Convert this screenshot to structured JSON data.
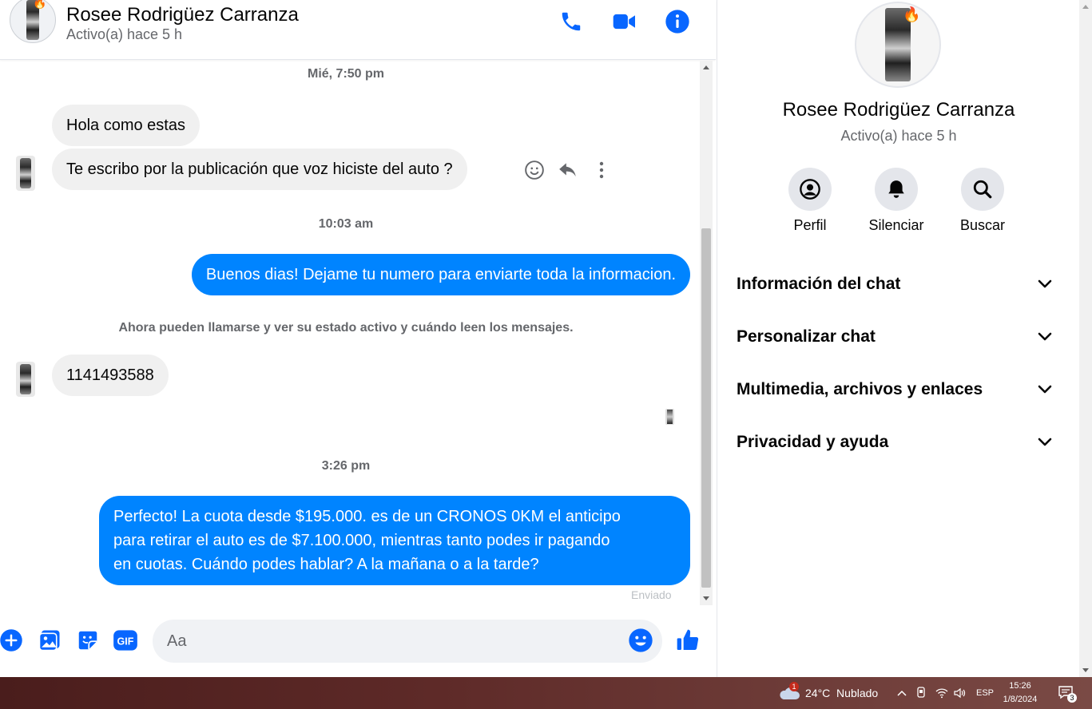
{
  "header": {
    "contact_name": "Rosee Rodrigüez Carranza",
    "status": "Activo(a) hace 5 h",
    "icons": [
      "phone-icon",
      "video-icon",
      "info-icon"
    ]
  },
  "messages": {
    "time_1": "Mié, 7:50 pm",
    "in_1": "Hola como estas",
    "in_2": "Te escribo por la publicación que voz hiciste del auto ?",
    "time_2": "10:03 am",
    "out_1": "Buenos dias! Dejame tu numero para enviarte toda la informacion.",
    "notice": "Ahora pueden llamarse y ver su estado activo y cuándo leen los mensajes.",
    "in_3": "1141493588",
    "time_3": "3:26 pm",
    "out_2_line1": "Perfecto! La cuota desde $195.000. es de un CRONOS 0KM el anticipo",
    "out_2_line2": "para retirar el auto es de $7.100.000, mientras tanto podes ir pagando",
    "out_2_line3": "en cuotas. Cuándo podes hablar? A la mañana o a la tarde?",
    "sent_label": "Enviado"
  },
  "composer": {
    "placeholder": "Aa",
    "gif_label": "GIF"
  },
  "info_panel": {
    "name": "Rosee Rodrigüez Carranza",
    "status": "Activo(a) hace 5 h",
    "actions": [
      {
        "label": "Perfil",
        "icon": "profile-icon"
      },
      {
        "label": "Silenciar",
        "icon": "bell-icon"
      },
      {
        "label": "Buscar",
        "icon": "search-icon"
      }
    ],
    "sections": [
      "Información del chat",
      "Personalizar chat",
      "Multimedia, archivos y enlaces",
      "Privacidad y ayuda"
    ]
  },
  "taskbar": {
    "weather": "24°C  Nublado",
    "weather_badge": "1",
    "language": "ESP",
    "time": "15:26",
    "date": "1/8/2024",
    "notifications": "3"
  },
  "colors": {
    "accent": "#0084ff",
    "incoming_bubble": "#f0f0f0",
    "icon_blue": "#0866ff"
  }
}
